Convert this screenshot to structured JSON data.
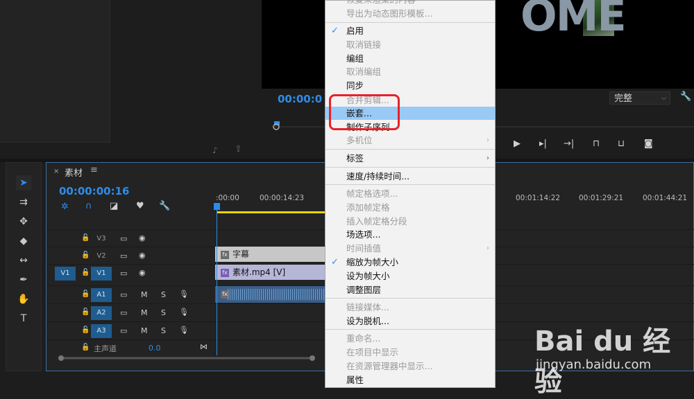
{
  "source_panel": {
    "icons": [
      "audio-icon",
      "export-icon"
    ]
  },
  "program_monitor": {
    "timecode": "00:00:0",
    "video_text": "OME",
    "quality": "完整"
  },
  "timeline": {
    "tab_title": "素材",
    "tab_menu": "≡",
    "timecode": "00:00:00:16",
    "time_labels": [
      ":00:00",
      "00:00:14:23",
      "00:01:14:22",
      "00:01:29:21",
      "00:01:44:21"
    ],
    "tracks": {
      "v3": "V3",
      "v2": "V2",
      "v1": "V1",
      "v1_source": "V1",
      "a1": "A1",
      "a2": "A2",
      "a3": "A3",
      "master": "主声道",
      "master_value": "0.0",
      "m": "M",
      "s": "S"
    },
    "clips": {
      "title": "字幕",
      "video": "素材.mp4 [V]",
      "fx": "fx"
    }
  },
  "context_menu": {
    "items": [
      {
        "label": "恢复未渲染的内容",
        "enabled": false
      },
      {
        "label": "导出为动态图形模板...",
        "enabled": false
      },
      {
        "label": "启用",
        "enabled": true,
        "checked": true
      },
      {
        "label": "取消链接",
        "enabled": false
      },
      {
        "label": "编组",
        "enabled": true
      },
      {
        "label": "取消编组",
        "enabled": false
      },
      {
        "label": "同步",
        "enabled": true
      },
      {
        "label": "合并剪辑...",
        "enabled": false
      },
      {
        "label": "嵌套...",
        "enabled": true,
        "highlighted": true
      },
      {
        "label": "制作子序列",
        "enabled": true
      },
      {
        "label": "多机位",
        "enabled": false,
        "submenu": true
      },
      {
        "label": "标签",
        "enabled": true,
        "submenu": true
      },
      {
        "label": "速度/持续时间...",
        "enabled": true
      },
      {
        "label": "帧定格选项...",
        "enabled": false
      },
      {
        "label": "添加帧定格",
        "enabled": false
      },
      {
        "label": "插入帧定格分段",
        "enabled": false
      },
      {
        "label": "场选项...",
        "enabled": true
      },
      {
        "label": "时间插值",
        "enabled": false,
        "submenu": true
      },
      {
        "label": "缩放为帧大小",
        "enabled": true,
        "checked": true
      },
      {
        "label": "设为帧大小",
        "enabled": true
      },
      {
        "label": "调整图层",
        "enabled": true
      },
      {
        "label": "链接媒体...",
        "enabled": false
      },
      {
        "label": "设为脱机...",
        "enabled": true
      },
      {
        "label": "重命名...",
        "enabled": false
      },
      {
        "label": "在项目中显示",
        "enabled": false
      },
      {
        "label": "在资源管理器中显示...",
        "enabled": false
      },
      {
        "label": "属性",
        "enabled": true
      }
    ],
    "submenu_arrow": "›",
    "checkmark": "✓"
  },
  "watermark": {
    "brand": "Bai du 经验",
    "url": "jingyan.baidu.com"
  },
  "colors": {
    "accent": "#2d8ceb",
    "highlight": "#99c9f5",
    "annotation": "#e8212a"
  }
}
